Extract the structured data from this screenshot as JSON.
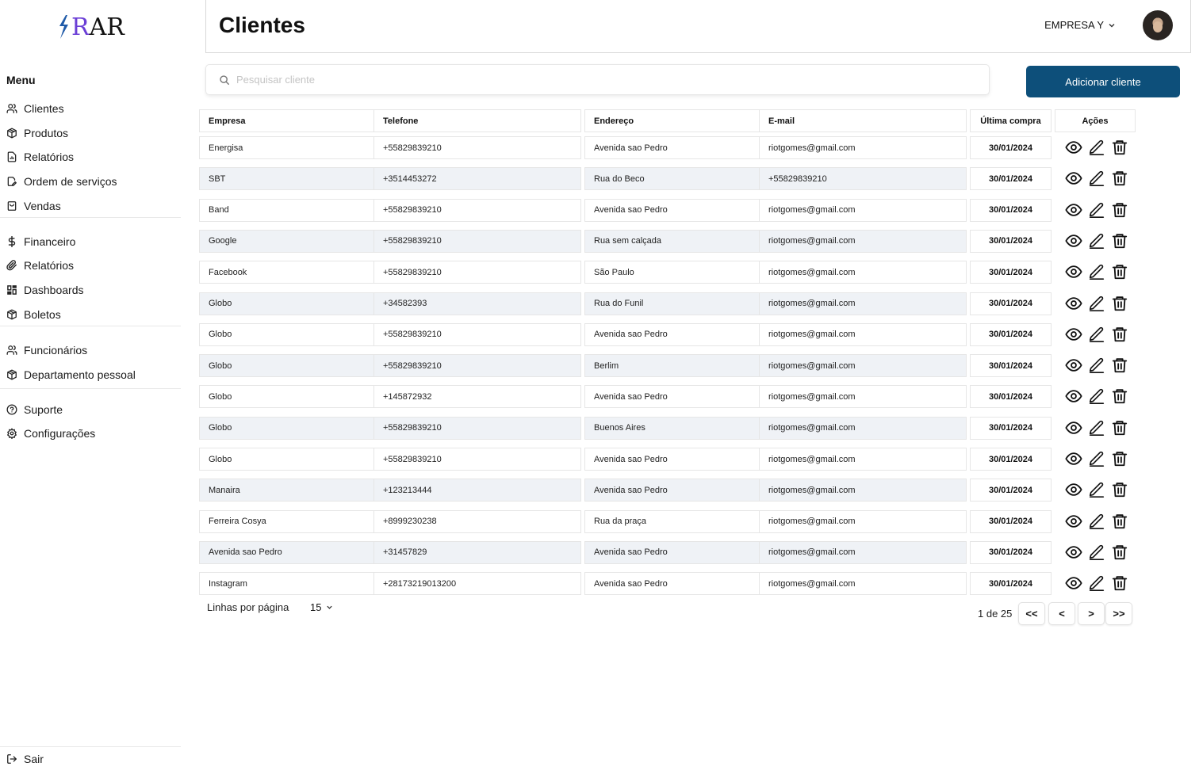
{
  "logo": {
    "prefix": "ϟ",
    "r": "R",
    "rest": "AR",
    "bolt_color": "#1f5aa8",
    "r_color": "#6b3fd6"
  },
  "sidebar": {
    "menu_title": "Menu",
    "items": [
      {
        "label": "Clientes",
        "icon": "users-icon"
      },
      {
        "label": "Produtos",
        "icon": "box-icon"
      },
      {
        "label": "Relatórios",
        "icon": "report-icon"
      },
      {
        "label": "Ordem de serviços",
        "icon": "edit-document-icon"
      },
      {
        "label": "Vendas",
        "icon": "shopping-bag-icon"
      },
      {
        "label": "Financeiro",
        "icon": "dollar-icon"
      },
      {
        "label": "Relatórios",
        "icon": "paperclip-icon"
      },
      {
        "label": "Dashboards",
        "icon": "dashboard-icon"
      },
      {
        "label": "Boletos",
        "icon": "box-icon"
      },
      {
        "label": "Funcionários",
        "icon": "users-icon"
      },
      {
        "label": "Departamento pessoal",
        "icon": "box-icon"
      },
      {
        "label": "Suporte",
        "icon": "help-circle-icon"
      },
      {
        "label": "Configurações",
        "icon": "gear-icon"
      }
    ],
    "logout_label": "Sair"
  },
  "header": {
    "title": "Clientes",
    "company": "EMPRESA Y"
  },
  "search": {
    "placeholder": "Pesquisar cliente",
    "value": ""
  },
  "add_button_label": "Adicionar cliente",
  "table": {
    "columns": [
      "Empresa",
      "Telefone",
      "Endereço",
      "E-mail",
      "Última compra",
      "Ações"
    ],
    "rows": [
      [
        "Energisa",
        "+55829839210",
        "Avenida sao Pedro",
        "riotgomes@gmail.com",
        "30/01/2024"
      ],
      [
        "SBT",
        "+3514453272",
        "Rua do Beco",
        "+55829839210",
        "30/01/2024"
      ],
      [
        "Band",
        "+55829839210",
        "Avenida sao Pedro",
        "riotgomes@gmail.com",
        "30/01/2024"
      ],
      [
        "Google",
        "+55829839210",
        "Rua sem calçada",
        "riotgomes@gmail.com",
        "30/01/2024"
      ],
      [
        "Facebook",
        "+55829839210",
        "São Paulo",
        "riotgomes@gmail.com",
        "30/01/2024"
      ],
      [
        "Globo",
        "+34582393",
        "Rua do Funil",
        "riotgomes@gmail.com",
        "30/01/2024"
      ],
      [
        "Globo",
        "+55829839210",
        "Avenida sao Pedro",
        "riotgomes@gmail.com",
        "30/01/2024"
      ],
      [
        "Globo",
        "+55829839210",
        "Berlim",
        "riotgomes@gmail.com",
        "30/01/2024"
      ],
      [
        "Globo",
        "+145872932",
        "Avenida sao Pedro",
        "riotgomes@gmail.com",
        "30/01/2024"
      ],
      [
        "Globo",
        "+55829839210",
        "Buenos Aires",
        "riotgomes@gmail.com",
        "30/01/2024"
      ],
      [
        "Globo",
        "+55829839210",
        "Avenida sao Pedro",
        "riotgomes@gmail.com",
        "30/01/2024"
      ],
      [
        "Manaira",
        "+123213444",
        "Avenida sao Pedro",
        "riotgomes@gmail.com",
        "30/01/2024"
      ],
      [
        "Ferreira Cosya",
        "+8999230238",
        "Rua da praça",
        "riotgomes@gmail.com",
        "30/01/2024"
      ],
      [
        "Avenida sao Pedro",
        "+31457829",
        "Avenida sao Pedro",
        "riotgomes@gmail.com",
        "30/01/2024"
      ],
      [
        "Instagram",
        "+28173219013200",
        "Avenida sao Pedro",
        "riotgomes@gmail.com",
        "30/01/2024"
      ]
    ],
    "row_actions": [
      "eye-icon",
      "pencil-icon",
      "trash-icon"
    ]
  },
  "pagination": {
    "rows_label": "Linhas por página",
    "rows_per_page": "15",
    "page_info": "1 de 25",
    "first": "<<",
    "prev": "<",
    "next": ">",
    "last": ">>"
  },
  "colors": {
    "primary_button": "#0d4f7a",
    "alt_row": "#eff2f6",
    "border": "#e6e6e6"
  }
}
